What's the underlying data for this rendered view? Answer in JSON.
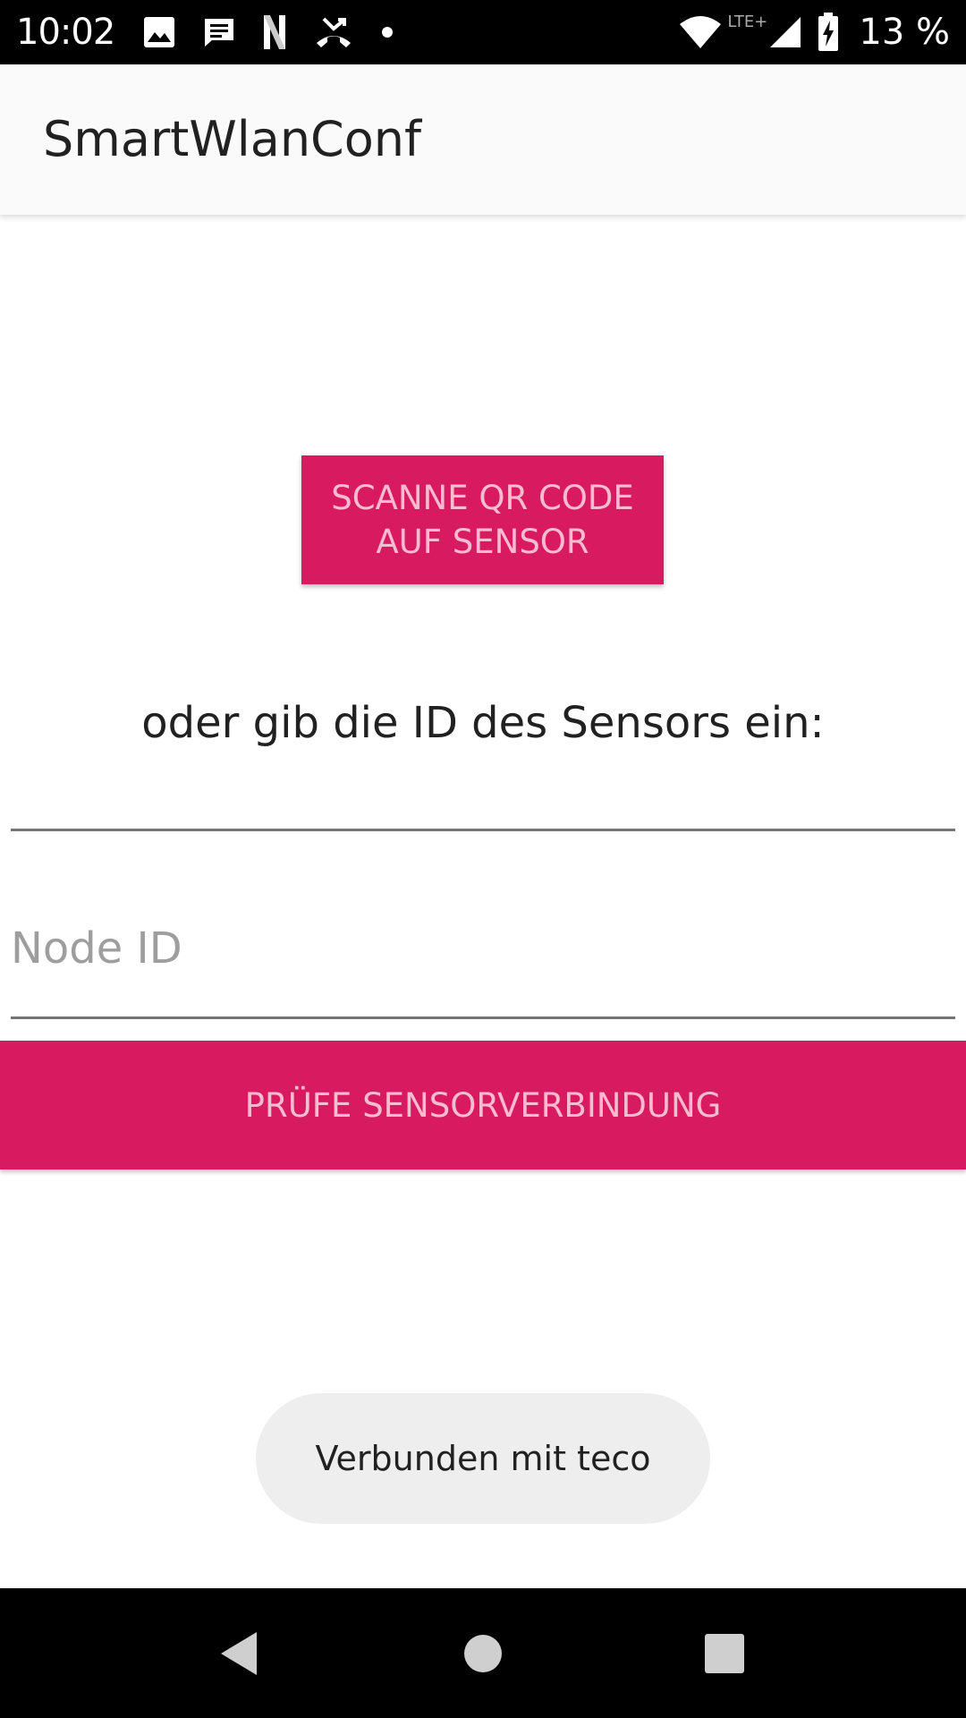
{
  "status_bar": {
    "time": "10:02",
    "network_label": "LTE+",
    "battery_percent": "13 %",
    "left_icons": [
      "image-icon",
      "message-icon",
      "netflix-icon",
      "missed-call-icon",
      "dot-icon"
    ],
    "right_icons": [
      "wifi-icon",
      "signal-icon",
      "battery-charging-icon"
    ]
  },
  "app_bar": {
    "title": "SmartWlanConf"
  },
  "main": {
    "scan_button_label": "SCANNE QR CODE\nAUF SENSOR",
    "instruction": "oder gib die ID des Sensors ein:",
    "node_id_field": {
      "value": "",
      "placeholder": "Node ID"
    },
    "check_button_label": "PRÜFE SENSORVERBINDUNG"
  },
  "toast": {
    "message": "Verbunden mit teco"
  },
  "nav_bar": {
    "icons": [
      "back-icon",
      "home-icon",
      "recents-icon"
    ]
  },
  "colors": {
    "accent": "#d81b60",
    "button_text": "#f8bbd0",
    "status_bar": "#000000",
    "app_bar": "#fafafa",
    "toast_bg": "#eeeeee"
  }
}
